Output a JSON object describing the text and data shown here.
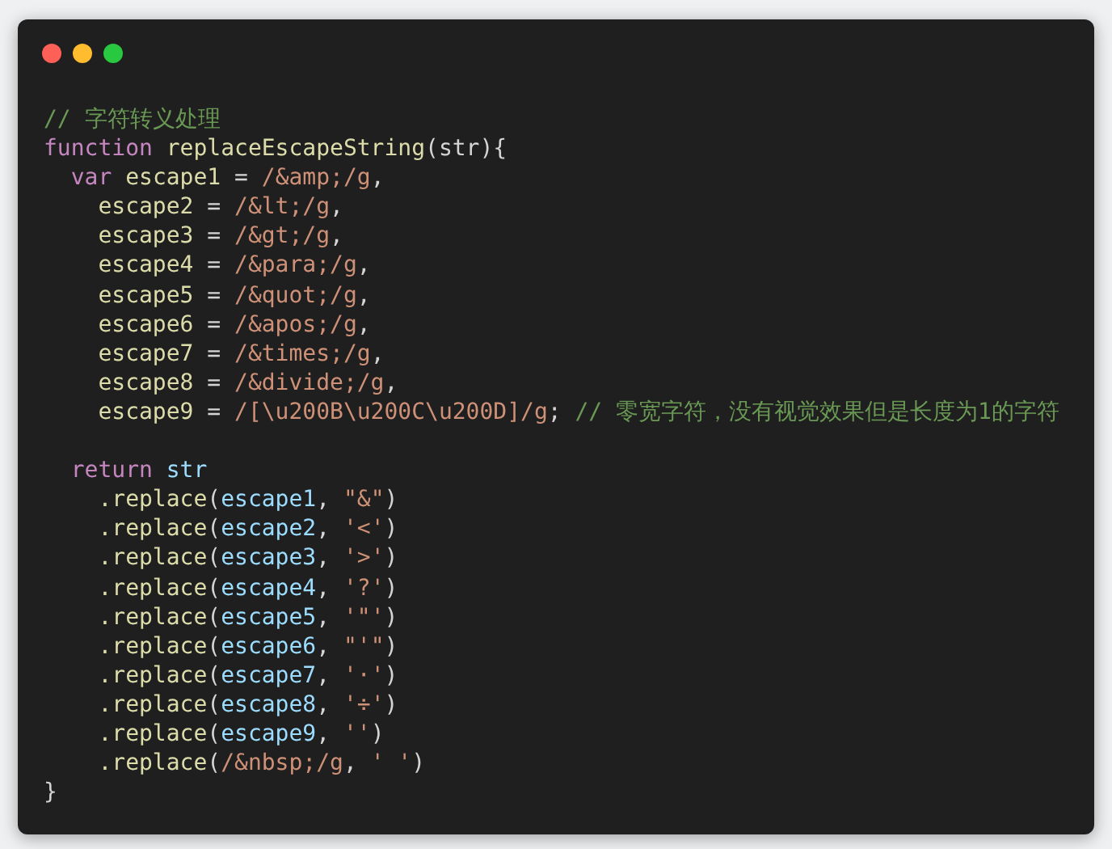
{
  "window": {
    "controls": [
      {
        "kind": "close"
      },
      {
        "kind": "minimize"
      },
      {
        "kind": "zoom"
      }
    ]
  },
  "code": {
    "lines": [
      {
        "kind": "code",
        "tokens": [
          {
            "kind": "comment",
            "text": "// 字符转义处理"
          }
        ]
      },
      {
        "kind": "code",
        "tokens": [
          {
            "kind": "keyword",
            "text": "function"
          },
          {
            "kind": "func",
            "text": " replaceEscapeString"
          },
          {
            "kind": "plain",
            "text": "(str){"
          }
        ]
      },
      {
        "kind": "code",
        "tokens": [
          {
            "kind": "keyword",
            "text": "  var"
          },
          {
            "kind": "decl",
            "text": " escape1"
          },
          {
            "kind": "plain",
            "text": " = "
          },
          {
            "kind": "string",
            "text": "/&amp;/g"
          },
          {
            "kind": "plain",
            "text": ","
          }
        ]
      },
      {
        "kind": "code",
        "tokens": [
          {
            "kind": "decl",
            "text": "    escape2"
          },
          {
            "kind": "plain",
            "text": " = "
          },
          {
            "kind": "string",
            "text": "/&lt;/g"
          },
          {
            "kind": "plain",
            "text": ","
          }
        ]
      },
      {
        "kind": "code",
        "tokens": [
          {
            "kind": "decl",
            "text": "    escape3"
          },
          {
            "kind": "plain",
            "text": " = "
          },
          {
            "kind": "string",
            "text": "/&gt;/g"
          },
          {
            "kind": "plain",
            "text": ","
          }
        ]
      },
      {
        "kind": "code",
        "tokens": [
          {
            "kind": "decl",
            "text": "    escape4"
          },
          {
            "kind": "plain",
            "text": " = "
          },
          {
            "kind": "string",
            "text": "/&para;/g"
          },
          {
            "kind": "plain",
            "text": ","
          }
        ]
      },
      {
        "kind": "code",
        "tokens": [
          {
            "kind": "decl",
            "text": "    escape5"
          },
          {
            "kind": "plain",
            "text": " = "
          },
          {
            "kind": "string",
            "text": "/&quot;/g"
          },
          {
            "kind": "plain",
            "text": ","
          }
        ]
      },
      {
        "kind": "code",
        "tokens": [
          {
            "kind": "decl",
            "text": "    escape6"
          },
          {
            "kind": "plain",
            "text": " = "
          },
          {
            "kind": "string",
            "text": "/&apos;/g"
          },
          {
            "kind": "plain",
            "text": ","
          }
        ]
      },
      {
        "kind": "code",
        "tokens": [
          {
            "kind": "decl",
            "text": "    escape7"
          },
          {
            "kind": "plain",
            "text": " = "
          },
          {
            "kind": "string",
            "text": "/&times;/g"
          },
          {
            "kind": "plain",
            "text": ","
          }
        ]
      },
      {
        "kind": "code",
        "tokens": [
          {
            "kind": "decl",
            "text": "    escape8"
          },
          {
            "kind": "plain",
            "text": " = "
          },
          {
            "kind": "string",
            "text": "/&divide;/g"
          },
          {
            "kind": "plain",
            "text": ","
          }
        ]
      },
      {
        "kind": "code",
        "tokens": [
          {
            "kind": "decl",
            "text": "    escape9"
          },
          {
            "kind": "plain",
            "text": " = "
          },
          {
            "kind": "string",
            "text": "/[\\u200B\\u200C\\u200D]/g"
          },
          {
            "kind": "plain",
            "text": "; "
          },
          {
            "kind": "comment",
            "text": "// 零宽字符，没有视觉效果但是长度为1的字符"
          }
        ]
      },
      {
        "kind": "blank"
      },
      {
        "kind": "code",
        "tokens": [
          {
            "kind": "keyword",
            "text": "  return"
          },
          {
            "kind": "var",
            "text": " str"
          }
        ]
      },
      {
        "kind": "code",
        "tokens": [
          {
            "kind": "func",
            "text": "    .replace"
          },
          {
            "kind": "plain",
            "text": "("
          },
          {
            "kind": "var",
            "text": "escape1"
          },
          {
            "kind": "plain",
            "text": ", "
          },
          {
            "kind": "string",
            "text": "\"&\""
          },
          {
            "kind": "plain",
            "text": ")"
          }
        ]
      },
      {
        "kind": "code",
        "tokens": [
          {
            "kind": "func",
            "text": "    .replace"
          },
          {
            "kind": "plain",
            "text": "("
          },
          {
            "kind": "var",
            "text": "escape2"
          },
          {
            "kind": "plain",
            "text": ", "
          },
          {
            "kind": "string",
            "text": "'<'"
          },
          {
            "kind": "plain",
            "text": ")"
          }
        ]
      },
      {
        "kind": "code",
        "tokens": [
          {
            "kind": "func",
            "text": "    .replace"
          },
          {
            "kind": "plain",
            "text": "("
          },
          {
            "kind": "var",
            "text": "escape3"
          },
          {
            "kind": "plain",
            "text": ", "
          },
          {
            "kind": "string",
            "text": "'>'"
          },
          {
            "kind": "plain",
            "text": ")"
          }
        ]
      },
      {
        "kind": "code",
        "tokens": [
          {
            "kind": "func",
            "text": "    .replace"
          },
          {
            "kind": "plain",
            "text": "("
          },
          {
            "kind": "var",
            "text": "escape4"
          },
          {
            "kind": "plain",
            "text": ", "
          },
          {
            "kind": "string",
            "text": "'?'"
          },
          {
            "kind": "plain",
            "text": ")"
          }
        ]
      },
      {
        "kind": "code",
        "tokens": [
          {
            "kind": "func",
            "text": "    .replace"
          },
          {
            "kind": "plain",
            "text": "("
          },
          {
            "kind": "var",
            "text": "escape5"
          },
          {
            "kind": "plain",
            "text": ", "
          },
          {
            "kind": "string",
            "text": "'\"'"
          },
          {
            "kind": "plain",
            "text": ")"
          }
        ]
      },
      {
        "kind": "code",
        "tokens": [
          {
            "kind": "func",
            "text": "    .replace"
          },
          {
            "kind": "plain",
            "text": "("
          },
          {
            "kind": "var",
            "text": "escape6"
          },
          {
            "kind": "plain",
            "text": ", "
          },
          {
            "kind": "string",
            "text": "\"'\""
          },
          {
            "kind": "plain",
            "text": ")"
          }
        ]
      },
      {
        "kind": "code",
        "tokens": [
          {
            "kind": "func",
            "text": "    .replace"
          },
          {
            "kind": "plain",
            "text": "("
          },
          {
            "kind": "var",
            "text": "escape7"
          },
          {
            "kind": "plain",
            "text": ", "
          },
          {
            "kind": "string",
            "text": "'·'"
          },
          {
            "kind": "plain",
            "text": ")"
          }
        ]
      },
      {
        "kind": "code",
        "tokens": [
          {
            "kind": "func",
            "text": "    .replace"
          },
          {
            "kind": "plain",
            "text": "("
          },
          {
            "kind": "var",
            "text": "escape8"
          },
          {
            "kind": "plain",
            "text": ", "
          },
          {
            "kind": "string",
            "text": "'÷'"
          },
          {
            "kind": "plain",
            "text": ")"
          }
        ]
      },
      {
        "kind": "code",
        "tokens": [
          {
            "kind": "func",
            "text": "    .replace"
          },
          {
            "kind": "plain",
            "text": "("
          },
          {
            "kind": "var",
            "text": "escape9"
          },
          {
            "kind": "plain",
            "text": ", "
          },
          {
            "kind": "string",
            "text": "''"
          },
          {
            "kind": "plain",
            "text": ")"
          }
        ]
      },
      {
        "kind": "code",
        "tokens": [
          {
            "kind": "func",
            "text": "    .replace"
          },
          {
            "kind": "plain",
            "text": "("
          },
          {
            "kind": "string",
            "text": "/&nbsp;/g"
          },
          {
            "kind": "plain",
            "text": ", "
          },
          {
            "kind": "string",
            "text": "' '"
          },
          {
            "kind": "plain",
            "text": ")"
          }
        ]
      },
      {
        "kind": "code",
        "tokens": [
          {
            "kind": "plain",
            "text": "}"
          }
        ]
      }
    ]
  }
}
